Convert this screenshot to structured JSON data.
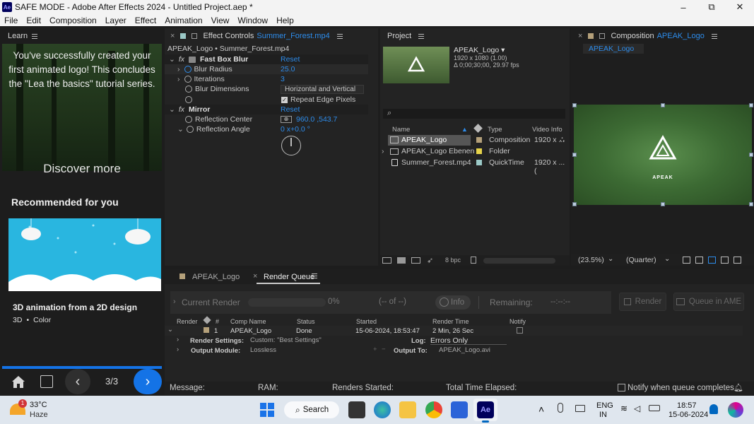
{
  "titlebar": {
    "title": "SAFE MODE - Adobe After Effects 2024 - Untitled Project.aep *",
    "ae_badge": "Ae",
    "minimize": "–",
    "maximize": "⧉",
    "close": "✕"
  },
  "menu": [
    "File",
    "Edit",
    "Composition",
    "Layer",
    "Effect",
    "Animation",
    "View",
    "Window",
    "Help"
  ],
  "learn": {
    "tab": "Learn",
    "hero_text": "You've successfully created your first animated logo! This concludes the \"Lea the basics\" tutorial series.",
    "discover": "Discover more",
    "recommended": "Recommended for you",
    "card_title": "3D animation from a 2D design",
    "card_tag1": "3D",
    "card_sep": "•",
    "card_tag2": "Color",
    "pager": "3/3"
  },
  "effects": {
    "tab_prefix": "Effect Controls",
    "tab_layer": "Summer_Forest.mp4",
    "breadcrumb": "APEAK_Logo • Summer_Forest.mp4",
    "fast_box_blur": "Fast Box Blur",
    "reset": "Reset",
    "blur_radius": "Blur Radius",
    "blur_radius_val": "25.0",
    "iterations": "Iterations",
    "iterations_val": "3",
    "blur_dimensions": "Blur Dimensions",
    "blur_dimensions_val": "Horizontal and Vertical",
    "repeat_edge": "Repeat Edge Pixels",
    "mirror": "Mirror",
    "mirror_reset": "Reset",
    "reflection_center": "Reflection Center",
    "reflection_center_val": "960.0 ,543.7",
    "reflection_angle": "Reflection Angle",
    "reflection_angle_val": "0 x+0.0 °"
  },
  "project": {
    "tab": "Project",
    "comp_name": "APEAK_Logo ▾",
    "comp_info1": "1920 x 1080 (1.00)",
    "comp_info2": "Δ 0;00;30;00, 29.97 fps",
    "search_icon": "⌕",
    "cols": {
      "name": "Name",
      "type": "Type",
      "video": "Video Info"
    },
    "rows": [
      {
        "name": "APEAK_Logo",
        "type": "Composition",
        "info": "1920 x ...",
        "color": "#b4a07a"
      },
      {
        "name": "APEAK_Logo Ebenen",
        "type": "Folder",
        "info": "",
        "color": "#e6d34a"
      },
      {
        "name": "Summer_Forest.mp4",
        "type": "QuickTime",
        "info": "1920 x ...(",
        "color": "#9bc9c7"
      }
    ],
    "bpc": "8 bpc"
  },
  "comp": {
    "tab_prefix": "Composition",
    "tab_name": "APEAK_Logo",
    "sub_tab": "APEAK_Logo",
    "logo_text": "APEAK",
    "zoom": "(23.5%)",
    "quality": "(Quarter)"
  },
  "rq": {
    "tab1": "APEAK_Logo",
    "tab2": "Render Queue",
    "current_render": "Current Render",
    "percent": "0%",
    "of": "(-- of --)",
    "info": "Info",
    "remaining": "Remaining:",
    "remaining_val": "--:--:--",
    "render_btn": "Render",
    "queue_ame": "Queue in AME",
    "cols": {
      "render": "Render",
      "num": "#",
      "comp": "Comp Name",
      "status": "Status",
      "started": "Started",
      "render_time": "Render Time",
      "notify": "Notify"
    },
    "item": {
      "num": "1",
      "comp": "APEAK_Logo",
      "status": "Done",
      "started": "15-06-2024, 18:53:47",
      "render_time": "2 Min, 26 Sec"
    },
    "render_settings": "Render Settings:",
    "render_settings_val": "Custom: \"Best Settings\"",
    "log": "Log:",
    "log_val": "Errors Only",
    "output_module": "Output Module:",
    "output_module_val": "Lossless",
    "output_to": "Output To:",
    "output_to_val": "APEAK_Logo.avi",
    "message": "Message:",
    "ram": "RAM:",
    "renders_started": "Renders Started:",
    "total_time": "Total Time Elapsed:",
    "notify_queue": "Notify when queue completes"
  },
  "taskbar": {
    "temp": "33°C",
    "weather": "Haze",
    "badge": "1",
    "search": "Search",
    "lang1": "ENG",
    "lang2": "IN",
    "time": "18:57",
    "date": "15-06-2024",
    "ae": "Ae"
  }
}
